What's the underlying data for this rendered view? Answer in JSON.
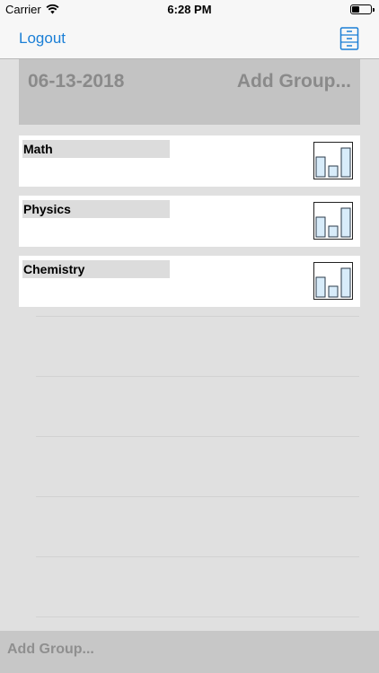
{
  "status_bar": {
    "carrier": "Carrier",
    "time": "6:28 PM"
  },
  "nav": {
    "logout_label": "Logout",
    "right_icon": "file-cabinet-icon"
  },
  "header": {
    "date": "06-13-2018",
    "add_group_label": "Add Group..."
  },
  "groups": [
    {
      "name": "Math",
      "icon": "bar-chart-icon"
    },
    {
      "name": "Physics",
      "icon": "bar-chart-icon"
    },
    {
      "name": "Chemistry",
      "icon": "bar-chart-icon"
    }
  ],
  "bottom_bar": {
    "add_group_label": "Add Group..."
  },
  "colors": {
    "accent": "#1b7fd6",
    "background": "#e0e0e0",
    "header_bg": "#c3c3c3",
    "chart_fill": "#d8ecfa"
  }
}
